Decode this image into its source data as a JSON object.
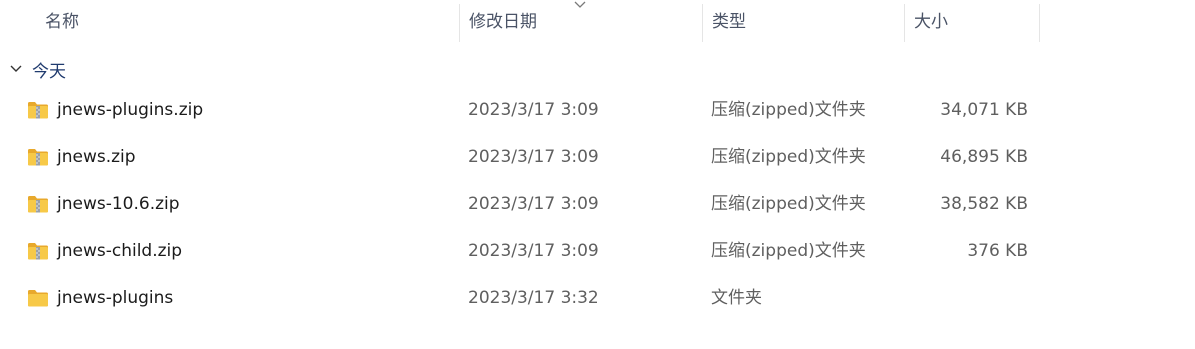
{
  "columns": {
    "name": "名称",
    "date": "修改日期",
    "type": "类型",
    "size": "大小"
  },
  "sort_icon": "chevron-down-icon",
  "group": {
    "label": "今天",
    "icon": "chevron-down-icon"
  },
  "files": [
    {
      "name": "jnews-plugins.zip",
      "date": "2023/3/17 3:09",
      "type": "压缩(zipped)文件夹",
      "size": "34,071 KB",
      "icon": "zip-folder-icon"
    },
    {
      "name": "jnews.zip",
      "date": "2023/3/17 3:09",
      "type": "压缩(zipped)文件夹",
      "size": "46,895 KB",
      "icon": "zip-folder-icon"
    },
    {
      "name": "jnews-10.6.zip",
      "date": "2023/3/17 3:09",
      "type": "压缩(zipped)文件夹",
      "size": "38,582 KB",
      "icon": "zip-folder-icon"
    },
    {
      "name": "jnews-child.zip",
      "date": "2023/3/17 3:09",
      "type": "压缩(zipped)文件夹",
      "size": "376 KB",
      "icon": "zip-folder-icon"
    },
    {
      "name": "jnews-plugins",
      "date": "2023/3/17 3:32",
      "type": "文件夹",
      "size": "",
      "icon": "folder-icon"
    }
  ],
  "colors": {
    "header_text": "#4a5366",
    "group_text": "#1f3a6e",
    "folder_yellow": "#f5c342",
    "secondary_text": "#5f5f5f"
  }
}
